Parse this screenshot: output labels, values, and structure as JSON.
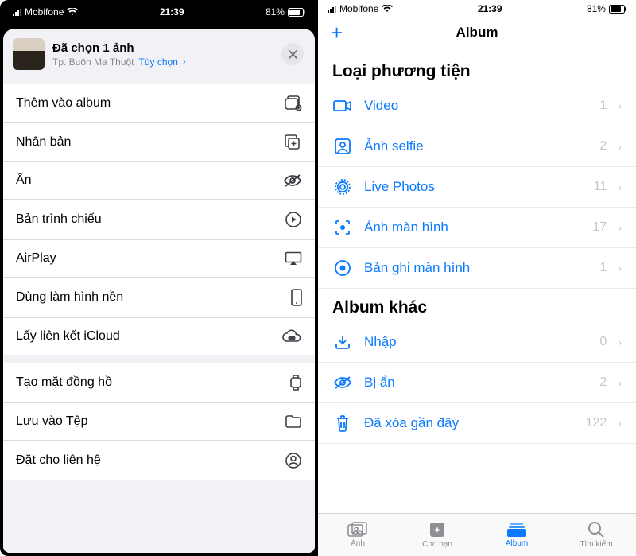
{
  "status": {
    "carrier": "Mobifone",
    "time": "21:39",
    "battery": "81%"
  },
  "sheet": {
    "title": "Đã chọn 1 ảnh",
    "subtitle": "Tp. Buôn Ma Thuột",
    "options_label": "Tùy chọn",
    "actions_group1": [
      {
        "label": "Thêm vào album",
        "icon": "add-album-icon",
        "highlight": false
      },
      {
        "label": "Nhân bản",
        "icon": "duplicate-icon",
        "highlight": false
      },
      {
        "label": "Ẩn",
        "icon": "hide-icon",
        "highlight": true
      },
      {
        "label": "Bản trình chiếu",
        "icon": "play-icon",
        "highlight": false
      },
      {
        "label": "AirPlay",
        "icon": "airplay-icon",
        "highlight": false
      },
      {
        "label": "Dùng làm hình nền",
        "icon": "phone-icon",
        "highlight": false
      },
      {
        "label": "Lấy liên kết iCloud",
        "icon": "cloud-link-icon",
        "highlight": false
      }
    ],
    "actions_group2": [
      {
        "label": "Tạo mặt đồng hồ",
        "icon": "watch-icon"
      },
      {
        "label": "Lưu vào Tệp",
        "icon": "folder-icon"
      },
      {
        "label": "Đặt cho liên hệ",
        "icon": "contact-icon"
      }
    ]
  },
  "album_screen": {
    "nav_title": "Album",
    "section_media": "Loại phương tiện",
    "media_types": [
      {
        "label": "Video",
        "count": "1",
        "icon": "video-icon"
      },
      {
        "label": "Ảnh selfie",
        "count": "2",
        "icon": "selfie-icon"
      },
      {
        "label": "Live Photos",
        "count": "11",
        "icon": "live-icon"
      },
      {
        "label": "Ảnh màn hình",
        "count": "17",
        "icon": "screenshot-icon"
      },
      {
        "label": "Bản ghi màn hình",
        "count": "1",
        "icon": "record-icon"
      }
    ],
    "section_other": "Album khác",
    "other_albums": [
      {
        "label": "Nhập",
        "count": "0",
        "icon": "import-icon",
        "highlight": false
      },
      {
        "label": "Bị ẩn",
        "count": "2",
        "icon": "hidden-icon",
        "highlight": true
      },
      {
        "label": "Đã xóa gần đây",
        "count": "122",
        "icon": "trash-icon",
        "highlight": false
      }
    ],
    "tabs": [
      {
        "label": "Ảnh",
        "active": false
      },
      {
        "label": "Cho bạn",
        "active": false
      },
      {
        "label": "Album",
        "active": true
      },
      {
        "label": "Tìm kiếm",
        "active": false
      }
    ]
  }
}
